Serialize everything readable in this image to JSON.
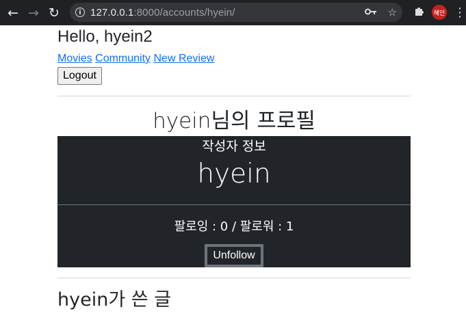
{
  "browser": {
    "url_host": "127.0.0.1",
    "url_path": ":8000/accounts/hyein/",
    "back_icon": "arrow-left-icon",
    "forward_icon": "arrow-right-icon",
    "reload_icon": "reload-icon",
    "profile_avatar_text": "혜인",
    "profile_avatar_color": "#c5221f"
  },
  "header": {
    "greeting": "Hello, hyein2",
    "nav_links": [
      "Movies",
      "Community",
      "New Review"
    ],
    "logout_label": "Logout"
  },
  "profile": {
    "title": "hyein님의 프로필",
    "card_subtitle": "작성자 정보",
    "username": "hyein",
    "follow_info": "팔로잉 : 0 / 팔로워 : 1",
    "unfollow_label": "Unfollow"
  },
  "posts_section": {
    "title": "hyein가 쓴 글"
  },
  "colors": {
    "card_background": "#212529",
    "link": "#0d6efd"
  }
}
